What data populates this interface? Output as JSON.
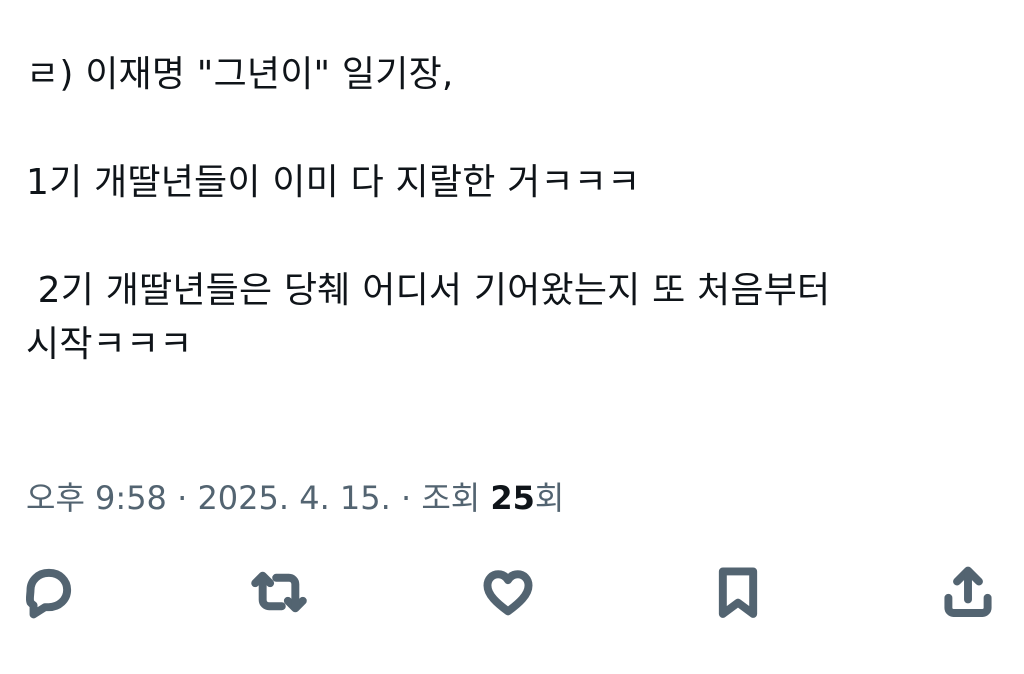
{
  "tweet": {
    "lines": [
      "ㄹ) 이재명 \"그년이\" 일기장,",
      "1기 개딸년들이 이미 다 지랄한 거ㅋㅋㅋ",
      " 2기 개딸년들은 당췌 어디서 기어왔는지 또 처음부터 시작ㅋㅋㅋ"
    ]
  },
  "meta": {
    "time": "오후 9:58",
    "separator": "·",
    "date": "2025. 4. 15.",
    "views_label": "조회",
    "views_count": "25",
    "views_suffix": "회"
  },
  "actions": {
    "reply_icon": "reply-icon",
    "retweet_icon": "retweet-icon",
    "like_icon": "heart-icon",
    "bookmark_icon": "bookmark-icon",
    "share_icon": "share-icon",
    "icon_color": "#536471"
  }
}
